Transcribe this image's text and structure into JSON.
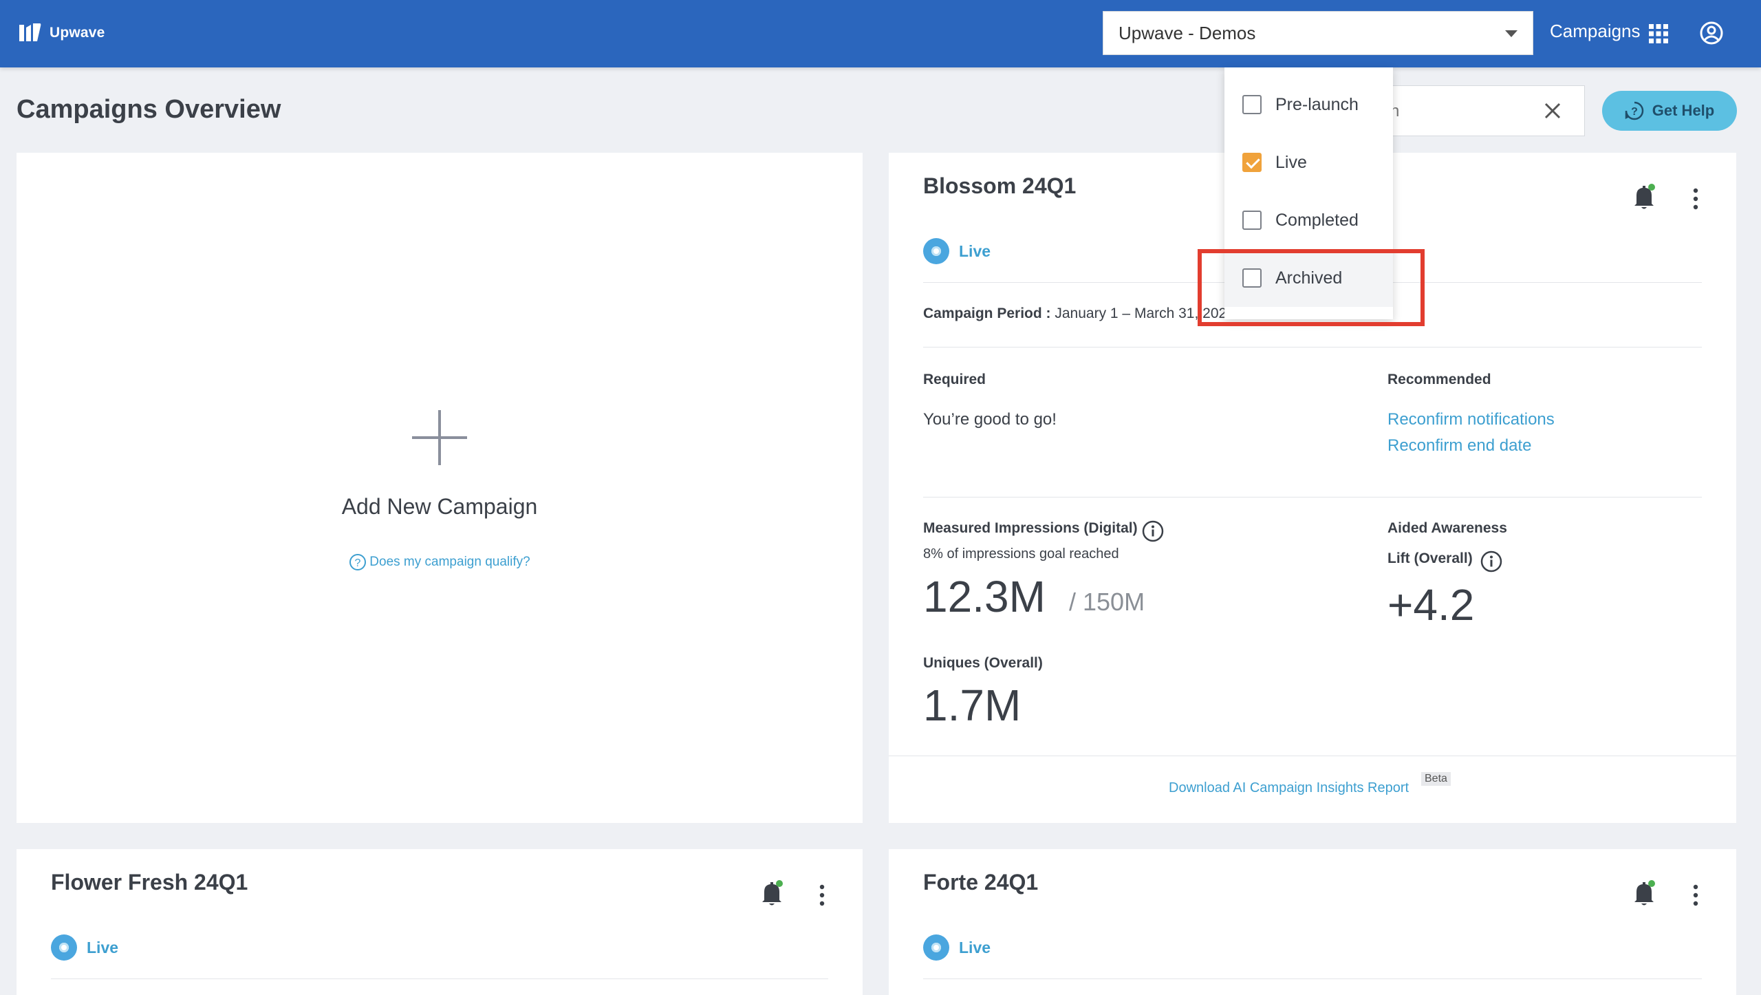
{
  "header": {
    "logo_text": "Upwave",
    "org_selector": "Upwave - Demos",
    "nav_campaigns": "Campaigns"
  },
  "page": {
    "title": "Campaigns Overview",
    "search_placeholder": "h",
    "help_label": "Get Help"
  },
  "status_filter": {
    "options": [
      {
        "label": "Pre-launch",
        "checked": false
      },
      {
        "label": "Live",
        "checked": true
      },
      {
        "label": "Completed",
        "checked": false
      },
      {
        "label": "Archived",
        "checked": false
      }
    ]
  },
  "add_card": {
    "title": "Add New Campaign",
    "qualify_link": "Does my campaign qualify?"
  },
  "campaigns": [
    {
      "name": "Blossom 24Q1",
      "status": "Live",
      "period_label": "Campaign Period :",
      "period_value": "January 1 – March 31, 2024",
      "required_label": "Required",
      "required_text": "You’re good to go!",
      "recommended_label": "Recommended",
      "recommended_links": [
        "Reconfirm notifications",
        "Reconfirm end date"
      ],
      "impressions_label": "Measured Impressions (Digital)",
      "impressions_goal_text": "8% of impressions goal reached",
      "impressions_value": "12.3M",
      "impressions_goal": "/ 150M",
      "awareness_label_1": "Aided Awareness",
      "awareness_label_2": "Lift (Overall)",
      "awareness_value": "+4.2",
      "uniques_label": "Uniques (Overall)",
      "uniques_value": "1.7M",
      "download_link": "Download AI Campaign Insights Report",
      "beta_badge": "Beta"
    },
    {
      "name": "Flower Fresh 24Q1",
      "status": "Live"
    },
    {
      "name": "Forte 24Q1",
      "status": "Live"
    }
  ],
  "colors": {
    "header_bg": "#2b66bd",
    "link": "#3d9fd0",
    "help_button": "#5cc0e2",
    "checkbox_checked": "#f0a23b",
    "highlight": "#e23d2f",
    "notification_dot": "#4caf50"
  }
}
